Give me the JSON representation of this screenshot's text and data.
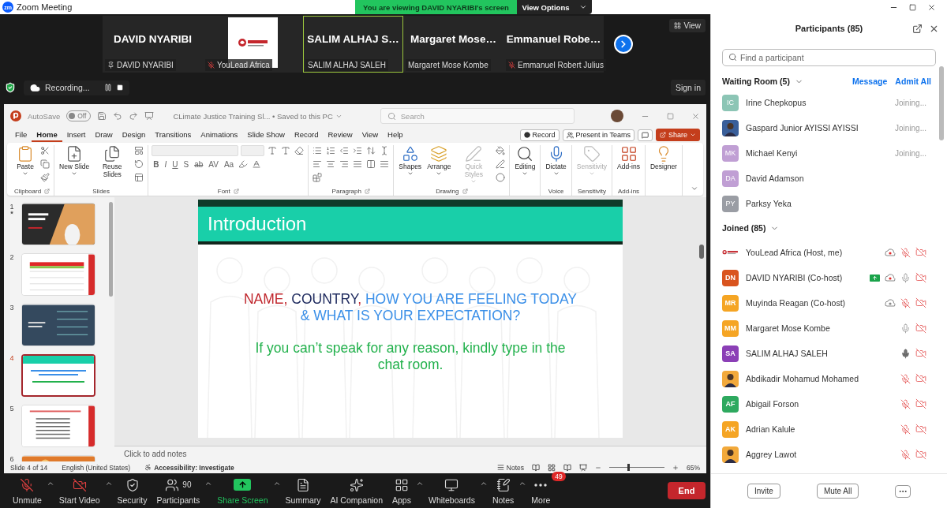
{
  "window": {
    "logo_text": "zm",
    "title": "Zoom Meeting"
  },
  "share_banner": {
    "text": "You are viewing DAVID NYARIBI's screen",
    "options": "View Options"
  },
  "video_tiles": [
    {
      "kind": "name",
      "display": "DAVID NYARIBI",
      "label": "DAVID NYARIBI",
      "pinned": true,
      "muted": false,
      "selected": false
    },
    {
      "kind": "logo",
      "label": "YouLead Africa",
      "pinned": false,
      "muted": true,
      "selected": false
    },
    {
      "kind": "name",
      "display": "SALIM ALHAJ S…",
      "label": "SALIM ALHAJ SALEH",
      "pinned": false,
      "muted": false,
      "selected": true
    },
    {
      "kind": "name",
      "display": "Margaret Mose…",
      "label": "Margaret Mose Kombe",
      "pinned": false,
      "muted": false,
      "selected": false
    },
    {
      "kind": "name",
      "display": "Emmanuel Robe…",
      "label": "Emmanuel Robert Julius",
      "pinned": false,
      "muted": true,
      "selected": false
    }
  ],
  "view_button": "View",
  "recording": {
    "label": "Recording...",
    "encrypted": true
  },
  "sign_in": "Sign in",
  "powerpoint": {
    "autosave": {
      "label": "AutoSave",
      "toggle": "Off",
      "on": false
    },
    "document": "CLimate Justice Training  Sl... • Saved to this PC",
    "search": {
      "placeholder": "Search"
    },
    "menu": [
      {
        "label": "File",
        "selected": false
      },
      {
        "label": "Home",
        "selected": true
      },
      {
        "label": "Insert",
        "selected": false
      },
      {
        "label": "Draw",
        "selected": false
      },
      {
        "label": "Design",
        "selected": false
      },
      {
        "label": "Transitions",
        "selected": false
      },
      {
        "label": "Animations",
        "selected": false
      },
      {
        "label": "Slide Show",
        "selected": false
      },
      {
        "label": "Record",
        "selected": false
      },
      {
        "label": "Review",
        "selected": false
      },
      {
        "label": "View",
        "selected": false
      },
      {
        "label": "Help",
        "selected": false
      }
    ],
    "record_button": "Record",
    "teams_button": "Present in Teams",
    "share_button": "Share",
    "ribbon": [
      {
        "label": "Clipboard",
        "launcher": true,
        "large": [
          {
            "kind": "paste",
            "label": "Paste",
            "dropdown": true,
            "disabled": false
          }
        ],
        "rows": [
          [
            {
              "kind": "cut"
            }
          ],
          [
            {
              "kind": "copy"
            }
          ],
          [
            {
              "kind": "painter"
            }
          ]
        ]
      },
      {
        "label": "Slides",
        "launcher": false,
        "large": [
          {
            "kind": "new_slide",
            "label": "New Slide",
            "dropdown": true,
            "disabled": false
          },
          {
            "kind": "reuse",
            "label": "Reuse Slides",
            "dropdown": false,
            "disabled": false
          }
        ],
        "rows": [
          [
            {
              "kind": "layout"
            }
          ],
          [
            {
              "kind": "reset"
            }
          ],
          [
            {
              "kind": "section"
            }
          ]
        ]
      },
      {
        "label": "Font",
        "launcher": true,
        "rows": [
          [
            {
              "kind": "fontbox"
            },
            {
              "kind": "sizebox"
            },
            {
              "kind": "grow"
            },
            {
              "kind": "shrink"
            },
            {
              "kind": "clear"
            }
          ],
          [
            {
              "kind": "bold",
              "label": "B"
            },
            {
              "kind": "italic",
              "label": "I"
            },
            {
              "kind": "underline",
              "label": "U"
            },
            {
              "kind": "shadow",
              "label": "S"
            },
            {
              "kind": "strike",
              "label": "ab"
            },
            {
              "kind": "spacing",
              "label": "AV"
            },
            {
              "kind": "case",
              "label": "Aa"
            },
            {
              "kind": "highlight"
            },
            {
              "kind": "fontcolor"
            }
          ]
        ]
      },
      {
        "label": "Paragraph",
        "launcher": true,
        "rows": [
          [
            {
              "kind": "bullets"
            },
            {
              "kind": "numbering"
            },
            {
              "kind": "outdent"
            },
            {
              "kind": "indent"
            },
            {
              "kind": "linespacing"
            },
            {
              "kind": "textdir"
            }
          ],
          [
            {
              "kind": "left"
            },
            {
              "kind": "center"
            },
            {
              "kind": "right"
            },
            {
              "kind": "justify"
            },
            {
              "kind": "columns"
            },
            {
              "kind": "aligntext"
            }
          ],
          [
            {
              "kind": "smartart"
            }
          ]
        ]
      },
      {
        "label": "Drawing",
        "launcher": true,
        "large": [
          {
            "kind": "shapes",
            "label": "Shapes",
            "dropdown": true,
            "disabled": false
          },
          {
            "kind": "arrange",
            "label": "Arrange",
            "dropdown": true,
            "disabled": false
          },
          {
            "kind": "quickstyles",
            "label": "Quick Styles",
            "dropdown": true,
            "disabled": true
          }
        ],
        "rows": [
          [
            {
              "kind": "fill"
            }
          ],
          [
            {
              "kind": "outline"
            }
          ],
          [
            {
              "kind": "effects"
            }
          ]
        ]
      },
      {
        "launcher": false,
        "large": [
          {
            "kind": "editing",
            "label": "Editing",
            "dropdown": true,
            "disabled": false
          }
        ]
      },
      {
        "label": "Voice",
        "launcher": false,
        "large": [
          {
            "kind": "dictate",
            "label": "Dictate",
            "dropdown": true,
            "disabled": false
          }
        ]
      },
      {
        "label": "Sensitivity",
        "launcher": false,
        "large": [
          {
            "kind": "sensitivity",
            "label": "Sensitivity",
            "dropdown": true,
            "disabled": true
          }
        ]
      },
      {
        "label": "Add-ins",
        "launcher": false,
        "large": [
          {
            "kind": "addins",
            "label": "Add-ins",
            "dropdown": false,
            "disabled": false
          }
        ]
      },
      {
        "launcher": false,
        "large": [
          {
            "kind": "designer",
            "label": "Designer",
            "dropdown": false,
            "disabled": false
          }
        ]
      }
    ],
    "thumbnails": [
      {
        "number": "1",
        "kind": "title",
        "selected": false,
        "starred": true
      },
      {
        "number": "2",
        "kind": "table",
        "selected": false,
        "starred": false
      },
      {
        "number": "3",
        "kind": "dark",
        "selected": false,
        "starred": false
      },
      {
        "number": "4",
        "kind": "intro",
        "selected": true,
        "starred": false
      },
      {
        "number": "5",
        "kind": "text",
        "selected": false,
        "starred": false
      },
      {
        "number": "6",
        "kind": "photo",
        "selected": false,
        "starred": false
      }
    ],
    "slide": {
      "title": "Introduction",
      "question": [
        {
          "text": "NAME,",
          "kind": "name"
        },
        {
          "text": " COUNTRY",
          "kind": "country"
        },
        {
          "text": ",",
          "kind": "name"
        },
        {
          "text": "  HOW YOU ARE FEELING TODAY & WHAT IS YOUR EXPECTATION?",
          "kind": "feeling"
        }
      ],
      "note": "If you can’t speak for any reason, kindly type in the chat room."
    },
    "notes_placeholder": "Click to add notes",
    "status_bar": {
      "slide": "Slide 4 of 14",
      "language": "English (United States)",
      "accessibility": "Accessibility: Investigate",
      "notes": "Notes",
      "zoom": "65%",
      "level": 0.33
    }
  },
  "toolbar": [
    {
      "kind": "mic",
      "label": "Unmute",
      "caret": true
    },
    {
      "kind": "video",
      "label": "Start Video",
      "caret": true
    },
    {
      "kind": "security",
      "label": "Security",
      "caret": false
    },
    {
      "kind": "participants",
      "label": "Participants",
      "count": "90",
      "caret": true
    },
    {
      "kind": "share",
      "label": "Share Screen",
      "caret": true
    },
    {
      "kind": "summary",
      "label": "Summary",
      "caret": false
    },
    {
      "kind": "ai",
      "label": "AI Companion",
      "caret": false
    },
    {
      "kind": "apps",
      "label": "Apps",
      "caret": true
    },
    {
      "kind": "whiteboard",
      "label": "Whiteboards",
      "caret": true
    },
    {
      "kind": "notes",
      "label": "Notes",
      "caret": true
    },
    {
      "kind": "more",
      "label": "More",
      "badge": "49",
      "caret": false
    }
  ],
  "end_button": "End",
  "participants_panel": {
    "title": "Participants (85)",
    "search": {
      "placeholder": "Find a participant"
    },
    "waiting_room": {
      "title": "Waiting Room (5)",
      "expanded": true,
      "actions": [
        "Message",
        "Admit All"
      ],
      "people": [
        {
          "kind": "initials",
          "initials": "IC",
          "color": "#8cc5b5",
          "name": "Irine Chepkopus",
          "status": "Joining..."
        },
        {
          "kind": "photo",
          "name": "Gaspard Junior AYISSI AYISSI",
          "status": "Joining..."
        },
        {
          "kind": "initials",
          "initials": "MK",
          "color": "#c09fd4",
          "name": "Michael Kenyi",
          "status": "Joining..."
        },
        {
          "kind": "initials",
          "initials": "DA",
          "color": "#c09fd4",
          "name": "David Adamson"
        },
        {
          "kind": "initials",
          "initials": "PY",
          "color": "#9a9da4",
          "name": "Parksy Yeka"
        }
      ]
    },
    "joined": {
      "title": "Joined (85)",
      "expanded": true,
      "people": [
        {
          "kind": "logo",
          "name": "YouLead Africa (Host, me)",
          "share": false,
          "cloud": true,
          "recording": true,
          "muted": true,
          "video_off": true
        },
        {
          "kind": "initials",
          "initials": "DN",
          "color": "#d9541e",
          "name": "DAVID NYARIBI (Co-host)",
          "share": true,
          "cloud": true,
          "recording": true,
          "muted": false,
          "speaking": false,
          "video_off": true
        },
        {
          "kind": "initials",
          "initials": "MR",
          "color": "#f5a524",
          "name": "Muyinda Reagan (Co-host)",
          "share": false,
          "cloud": true,
          "recording": false,
          "muted": true,
          "video_off": true
        },
        {
          "kind": "initials",
          "initials": "MM",
          "color": "#f5a524",
          "name": "Margaret Mose Kombe",
          "share": false,
          "cloud": false,
          "muted": false,
          "speaking": false,
          "video_off": true
        },
        {
          "kind": "initials",
          "initials": "SA",
          "color": "#8b3fb6",
          "name": "SALIM ALHAJ SALEH",
          "share": false,
          "cloud": false,
          "muted": false,
          "speaking": true,
          "video_off": true
        },
        {
          "kind": "photo",
          "name": "Abdikadir Mohamud Mohamed",
          "share": false,
          "cloud": false,
          "muted": true,
          "video_off": true
        },
        {
          "kind": "initials",
          "initials": "AF",
          "color": "#2ea95f",
          "name": "Abigail Forson",
          "share": false,
          "cloud": false,
          "muted": true,
          "video_off": true
        },
        {
          "kind": "initials",
          "initials": "AK",
          "color": "#f5a524",
          "name": "Adrian Kalule",
          "share": false,
          "cloud": false,
          "muted": true,
          "video_off": true
        },
        {
          "kind": "photo",
          "name": "Aggrey Lawot",
          "share": false,
          "cloud": false,
          "muted": true,
          "video_off": true
        }
      ]
    },
    "footer_buttons": [
      "Invite",
      "Mute All"
    ]
  }
}
